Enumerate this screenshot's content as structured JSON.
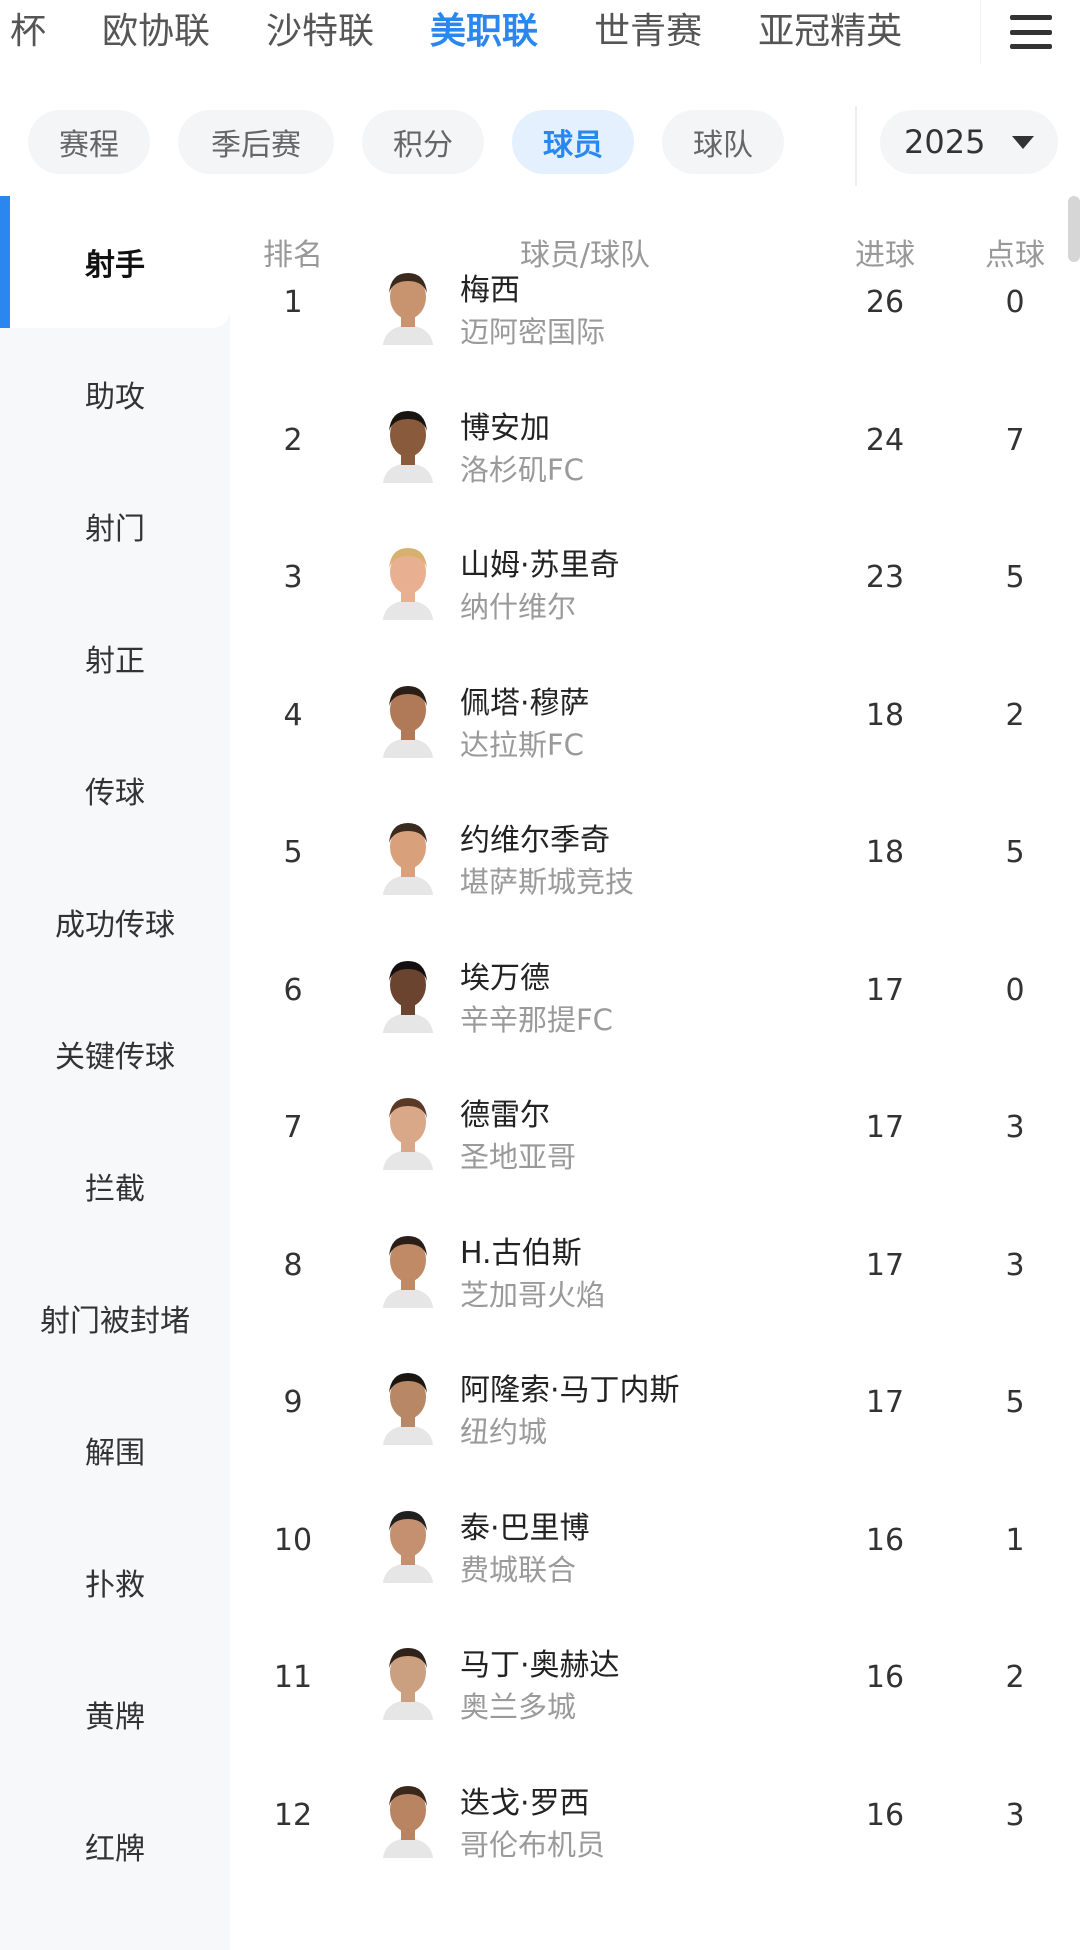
{
  "league_tabs": [
    "杯",
    "欧协联",
    "沙特联",
    "美职联",
    "世青赛",
    "亚冠精英"
  ],
  "active_league": "美职联",
  "sub_tabs": [
    "赛程",
    "季后赛",
    "积分",
    "球员",
    "球队"
  ],
  "active_sub_tab": "球员",
  "season": "2025",
  "categories": [
    "射手",
    "助攻",
    "射门",
    "射正",
    "传球",
    "成功传球",
    "关键传球",
    "拦截",
    "射门被封堵",
    "解围",
    "扑救",
    "黄牌",
    "红牌"
  ],
  "active_category": "射手",
  "table_headers": {
    "rank": "排名",
    "player_team": "球员/球队",
    "goals": "进球",
    "penalties": "点球"
  },
  "players": [
    {
      "rank": "1",
      "name": "梅西",
      "team": "迈阿密国际",
      "goals": "26",
      "penalties": "0"
    },
    {
      "rank": "2",
      "name": "博安加",
      "team": "洛杉矶FC",
      "goals": "24",
      "penalties": "7"
    },
    {
      "rank": "3",
      "name": "山姆·苏里奇",
      "team": "纳什维尔",
      "goals": "23",
      "penalties": "5"
    },
    {
      "rank": "4",
      "name": "佩塔·穆萨",
      "team": "达拉斯FC",
      "goals": "18",
      "penalties": "2"
    },
    {
      "rank": "5",
      "name": "约维尔季奇",
      "team": "堪萨斯城竞技",
      "goals": "18",
      "penalties": "5"
    },
    {
      "rank": "6",
      "name": "埃万德",
      "team": "辛辛那提FC",
      "goals": "17",
      "penalties": "0"
    },
    {
      "rank": "7",
      "name": "德雷尔",
      "team": "圣地亚哥",
      "goals": "17",
      "penalties": "3"
    },
    {
      "rank": "8",
      "name": "H.古伯斯",
      "team": "芝加哥火焰",
      "goals": "17",
      "penalties": "3"
    },
    {
      "rank": "9",
      "name": "阿隆索·马丁内斯",
      "team": "纽约城",
      "goals": "17",
      "penalties": "5"
    },
    {
      "rank": "10",
      "name": "泰·巴里博",
      "team": "费城联合",
      "goals": "16",
      "penalties": "1"
    },
    {
      "rank": "11",
      "name": "马丁·奥赫达",
      "team": "奥兰多城",
      "goals": "16",
      "penalties": "2"
    },
    {
      "rank": "12",
      "name": "迭戈·罗西",
      "team": "哥伦布机员",
      "goals": "16",
      "penalties": "3"
    }
  ],
  "icons": {
    "menu": "hamburger-menu-icon",
    "dropdown": "caret-down-icon"
  },
  "colors": {
    "accent": "#2b87f0",
    "active_pill_bg": "#e4f0fd",
    "sidebar_bg": "#f6f8fa"
  }
}
